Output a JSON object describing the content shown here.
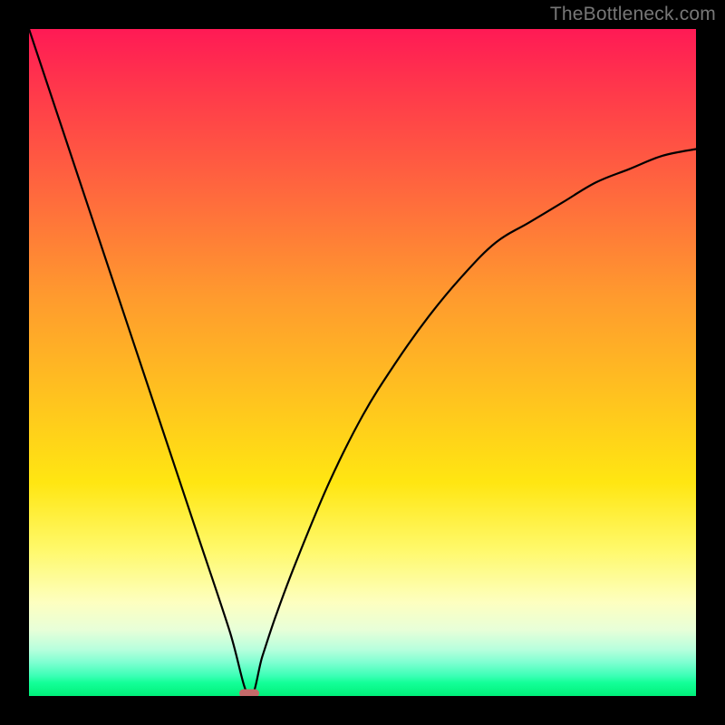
{
  "watermark": "TheBottleneck.com",
  "marker": {
    "color": "#c46a6a"
  },
  "chart_data": {
    "type": "line",
    "title": "",
    "xlabel": "",
    "ylabel": "",
    "xlim": [
      0,
      100
    ],
    "ylim": [
      0,
      100
    ],
    "grid": false,
    "legend": false,
    "annotations": [],
    "series": [
      {
        "name": "bottleneck-curve",
        "x": [
          0,
          5,
          10,
          15,
          20,
          25,
          30,
          33,
          35,
          37,
          40,
          45,
          50,
          55,
          60,
          65,
          70,
          75,
          80,
          85,
          90,
          95,
          100
        ],
        "y": [
          100,
          85,
          70,
          55,
          40,
          25,
          10,
          0,
          6,
          12,
          20,
          32,
          42,
          50,
          57,
          63,
          68,
          71,
          74,
          77,
          79,
          81,
          82
        ]
      }
    ],
    "minimum_marker": {
      "x": 33,
      "y": 0
    },
    "background": {
      "type": "vertical-gradient",
      "stops": [
        {
          "pos": 0,
          "color": "#ff1a55"
        },
        {
          "pos": 25,
          "color": "#ff6a3d"
        },
        {
          "pos": 55,
          "color": "#ffc21f"
        },
        {
          "pos": 78,
          "color": "#fff96a"
        },
        {
          "pos": 93,
          "color": "#b8ffdd"
        },
        {
          "pos": 100,
          "color": "#00f07a"
        }
      ]
    }
  }
}
